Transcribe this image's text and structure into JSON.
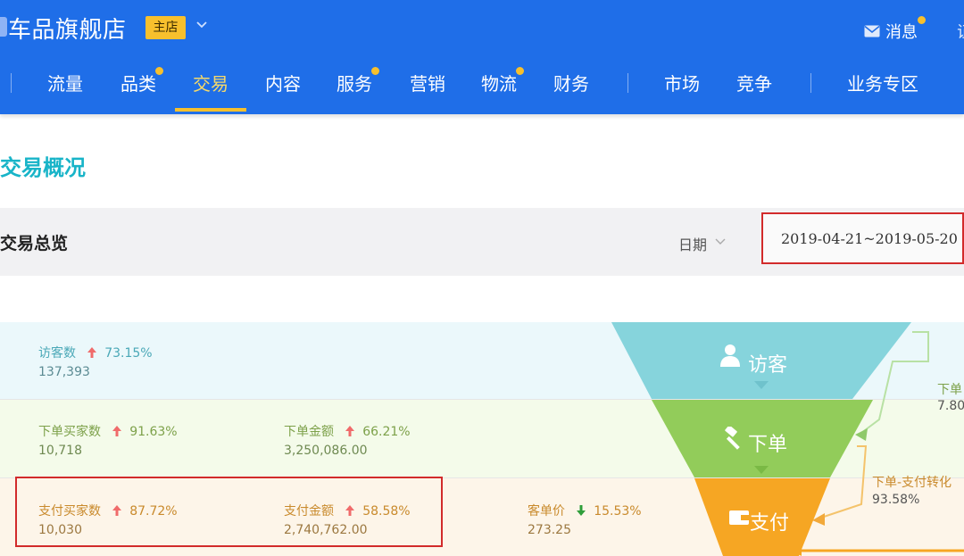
{
  "header": {
    "shop_name": "车品旗舰店",
    "badge": "主店",
    "message_label": "消息",
    "cut_text": "证"
  },
  "nav": {
    "items": [
      {
        "label": "流量",
        "dot": false
      },
      {
        "label": "品类",
        "dot": true
      },
      {
        "label": "交易",
        "dot": false,
        "active": true
      },
      {
        "label": "内容",
        "dot": false
      },
      {
        "label": "服务",
        "dot": true
      },
      {
        "label": "营销",
        "dot": false
      },
      {
        "label": "物流",
        "dot": true
      },
      {
        "label": "财务",
        "dot": false
      },
      {
        "label": "市场",
        "dot": false
      },
      {
        "label": "竞争",
        "dot": false
      },
      {
        "label": "业务专区",
        "dot": false
      }
    ]
  },
  "page": {
    "title": "交易概况"
  },
  "overview": {
    "title": "交易总览",
    "date_label": "日期",
    "date_range": "2019-04-21~2019-05-20"
  },
  "funnel": {
    "stages": [
      {
        "label": "访客",
        "icon": "user-icon",
        "color": "#86d4dc"
      },
      {
        "label": "下单",
        "icon": "gavel-icon",
        "color": "#92cc5a"
      },
      {
        "label": "支付",
        "icon": "wallet-icon",
        "color": "#f6a623"
      }
    ],
    "metrics": {
      "visitors": {
        "label": "访客数",
        "change": "73.15%",
        "direction": "up",
        "value": "137,393"
      },
      "order_buyers": {
        "label": "下单买家数",
        "change": "91.63%",
        "direction": "up",
        "value": "10,718"
      },
      "order_amount": {
        "label": "下单金额",
        "change": "66.21%",
        "direction": "up",
        "value": "3,250,086.00"
      },
      "pay_buyers": {
        "label": "支付买家数",
        "change": "87.72%",
        "direction": "up",
        "value": "10,030"
      },
      "pay_amount": {
        "label": "支付金额",
        "change": "58.58%",
        "direction": "up",
        "value": "2,740,762.00"
      },
      "unit_price": {
        "label": "客单价",
        "change": "15.53%",
        "direction": "down",
        "value": "273.25"
      }
    },
    "side": {
      "visit_to_order": {
        "label": "下单",
        "value": "7.80"
      },
      "order_to_pay": {
        "label": "下单-支付转化",
        "value": "93.58%"
      }
    }
  },
  "colors": {
    "header_blue": "#1f6ee8",
    "accent_yellow": "#f7c02d",
    "title_teal": "#18b4c8",
    "highlight_red": "#d22b2b",
    "up_arrow": "#f06b6b",
    "down_arrow": "#2f9e3a"
  }
}
